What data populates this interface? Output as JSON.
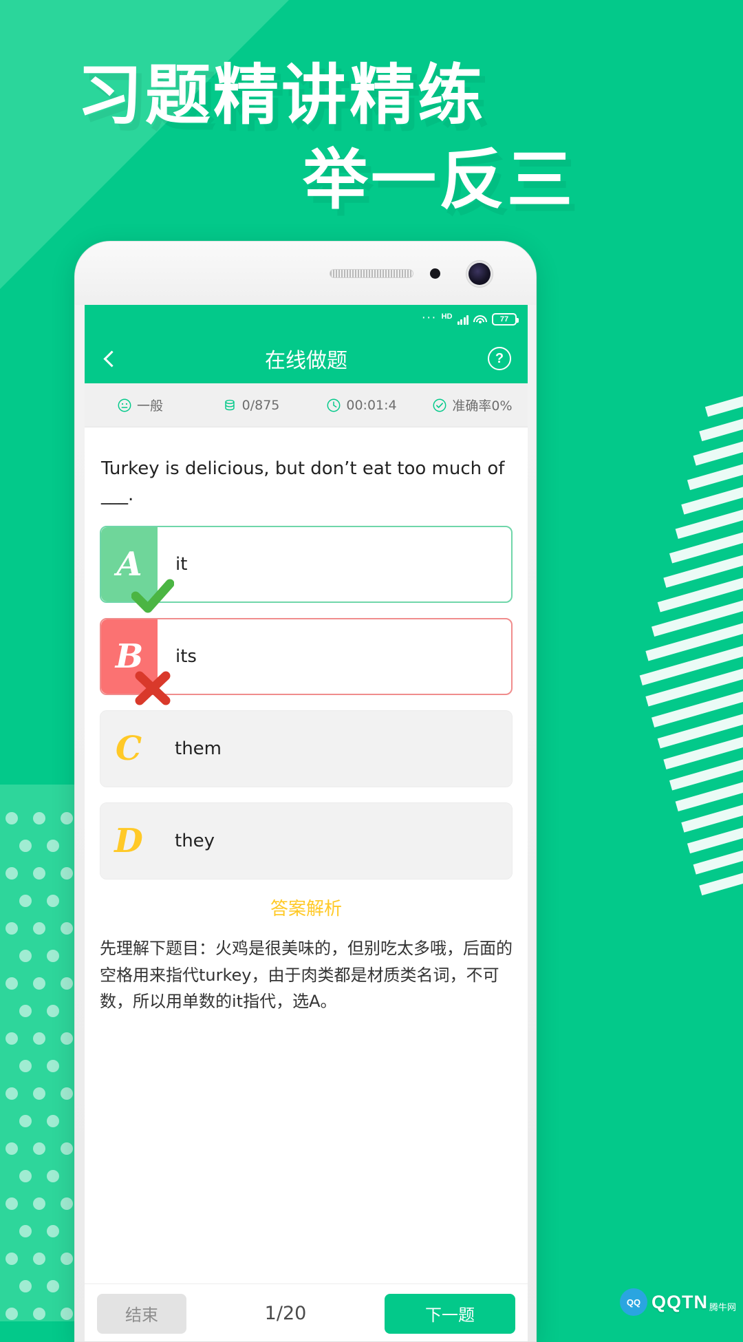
{
  "promo": {
    "headline_line1": "习题精讲精练",
    "headline_line2": "举一反三",
    "bg_color": "#03c98a",
    "accent_color": "#2ed69b"
  },
  "phone": {
    "status_bar": {
      "dots": "···",
      "hd_label": "HD",
      "signal_icon": "signal-bars-icon",
      "wifi_icon": "wifi-icon",
      "battery_level": "77"
    },
    "header": {
      "back_icon": "back-chevron-icon",
      "title": "在线做题",
      "help_icon": "question-mark-icon",
      "bg_color": "#03c98a"
    },
    "stats": [
      {
        "icon": "smiley-face-icon",
        "label": "一般"
      },
      {
        "icon": "database-stack-icon",
        "label": "0/875"
      },
      {
        "icon": "clock-icon",
        "label": "00:01:4"
      },
      {
        "icon": "check-circle-icon",
        "label": "准确率0%"
      }
    ],
    "question": {
      "text": "Turkey is delicious, but don’t eat too much of ___.",
      "options": [
        {
          "letter": "A",
          "text": "it",
          "state": "correct",
          "mark": "check-mark-icon"
        },
        {
          "letter": "B",
          "text": "its",
          "state": "wrong",
          "mark": "cross-mark-icon"
        },
        {
          "letter": "C",
          "text": "them",
          "state": "neutral",
          "mark": ""
        },
        {
          "letter": "D",
          "text": "they",
          "state": "neutral",
          "mark": ""
        }
      ]
    },
    "answer": {
      "section_title": "答案解析",
      "explanation": "先理解下题目：火鸡是很美味的，但别吃太多哦，后面的空格用来指代turkey，由于肉类都是材质类名词，不可数，所以用单数的it指代，选A。",
      "title_color": "#ffc927"
    },
    "footer": {
      "end_label": "结束",
      "page_indicator": "1/20",
      "next_label": "下一题",
      "next_color": "#03c98a"
    }
  },
  "watermark": {
    "badge": "QQ",
    "text": "QQTN",
    "sub": "腾牛网"
  }
}
